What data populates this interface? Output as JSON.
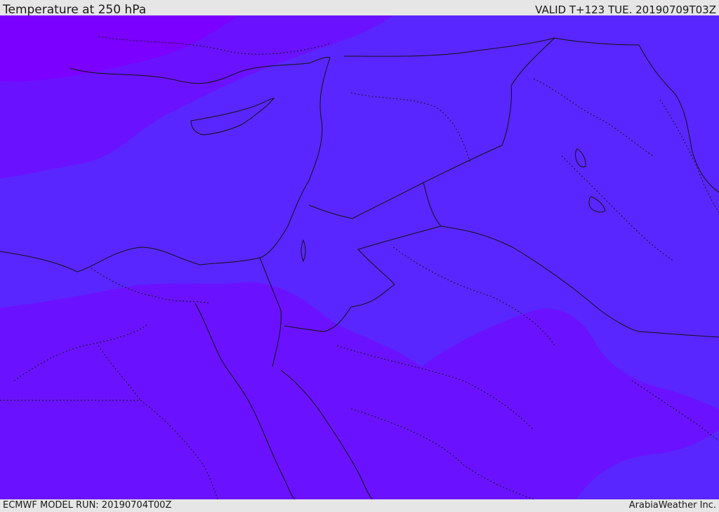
{
  "header": {
    "title": "Temperature at 250 hPa",
    "valid": "VALID T+123 TUE. 20190709T03Z"
  },
  "footer": {
    "model_run": "ECMWF MODEL RUN: 20190704T00Z",
    "credit": "ArabiaWeather Inc."
  },
  "colors": {
    "band_coldest": "#7b00ff",
    "band_cold": "#6a12ff",
    "band_mid": "#5a26ff",
    "border_line": "#111111"
  }
}
